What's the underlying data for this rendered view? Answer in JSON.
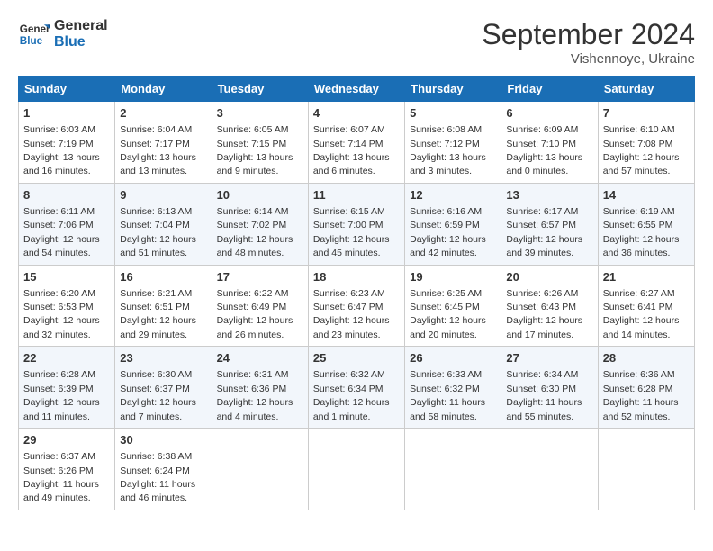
{
  "header": {
    "logo_line1": "General",
    "logo_line2": "Blue",
    "month": "September 2024",
    "location": "Vishennoye, Ukraine"
  },
  "days_of_week": [
    "Sunday",
    "Monday",
    "Tuesday",
    "Wednesday",
    "Thursday",
    "Friday",
    "Saturday"
  ],
  "weeks": [
    [
      {
        "day": "1",
        "sunrise": "6:03 AM",
        "sunset": "7:19 PM",
        "daylight": "13 hours and 16 minutes."
      },
      {
        "day": "2",
        "sunrise": "6:04 AM",
        "sunset": "7:17 PM",
        "daylight": "13 hours and 13 minutes."
      },
      {
        "day": "3",
        "sunrise": "6:05 AM",
        "sunset": "7:15 PM",
        "daylight": "13 hours and 9 minutes."
      },
      {
        "day": "4",
        "sunrise": "6:07 AM",
        "sunset": "7:14 PM",
        "daylight": "13 hours and 6 minutes."
      },
      {
        "day": "5",
        "sunrise": "6:08 AM",
        "sunset": "7:12 PM",
        "daylight": "13 hours and 3 minutes."
      },
      {
        "day": "6",
        "sunrise": "6:09 AM",
        "sunset": "7:10 PM",
        "daylight": "13 hours and 0 minutes."
      },
      {
        "day": "7",
        "sunrise": "6:10 AM",
        "sunset": "7:08 PM",
        "daylight": "12 hours and 57 minutes."
      }
    ],
    [
      {
        "day": "8",
        "sunrise": "6:11 AM",
        "sunset": "7:06 PM",
        "daylight": "12 hours and 54 minutes."
      },
      {
        "day": "9",
        "sunrise": "6:13 AM",
        "sunset": "7:04 PM",
        "daylight": "12 hours and 51 minutes."
      },
      {
        "day": "10",
        "sunrise": "6:14 AM",
        "sunset": "7:02 PM",
        "daylight": "12 hours and 48 minutes."
      },
      {
        "day": "11",
        "sunrise": "6:15 AM",
        "sunset": "7:00 PM",
        "daylight": "12 hours and 45 minutes."
      },
      {
        "day": "12",
        "sunrise": "6:16 AM",
        "sunset": "6:59 PM",
        "daylight": "12 hours and 42 minutes."
      },
      {
        "day": "13",
        "sunrise": "6:17 AM",
        "sunset": "6:57 PM",
        "daylight": "12 hours and 39 minutes."
      },
      {
        "day": "14",
        "sunrise": "6:19 AM",
        "sunset": "6:55 PM",
        "daylight": "12 hours and 36 minutes."
      }
    ],
    [
      {
        "day": "15",
        "sunrise": "6:20 AM",
        "sunset": "6:53 PM",
        "daylight": "12 hours and 32 minutes."
      },
      {
        "day": "16",
        "sunrise": "6:21 AM",
        "sunset": "6:51 PM",
        "daylight": "12 hours and 29 minutes."
      },
      {
        "day": "17",
        "sunrise": "6:22 AM",
        "sunset": "6:49 PM",
        "daylight": "12 hours and 26 minutes."
      },
      {
        "day": "18",
        "sunrise": "6:23 AM",
        "sunset": "6:47 PM",
        "daylight": "12 hours and 23 minutes."
      },
      {
        "day": "19",
        "sunrise": "6:25 AM",
        "sunset": "6:45 PM",
        "daylight": "12 hours and 20 minutes."
      },
      {
        "day": "20",
        "sunrise": "6:26 AM",
        "sunset": "6:43 PM",
        "daylight": "12 hours and 17 minutes."
      },
      {
        "day": "21",
        "sunrise": "6:27 AM",
        "sunset": "6:41 PM",
        "daylight": "12 hours and 14 minutes."
      }
    ],
    [
      {
        "day": "22",
        "sunrise": "6:28 AM",
        "sunset": "6:39 PM",
        "daylight": "12 hours and 11 minutes."
      },
      {
        "day": "23",
        "sunrise": "6:30 AM",
        "sunset": "6:37 PM",
        "daylight": "12 hours and 7 minutes."
      },
      {
        "day": "24",
        "sunrise": "6:31 AM",
        "sunset": "6:36 PM",
        "daylight": "12 hours and 4 minutes."
      },
      {
        "day": "25",
        "sunrise": "6:32 AM",
        "sunset": "6:34 PM",
        "daylight": "12 hours and 1 minute."
      },
      {
        "day": "26",
        "sunrise": "6:33 AM",
        "sunset": "6:32 PM",
        "daylight": "11 hours and 58 minutes."
      },
      {
        "day": "27",
        "sunrise": "6:34 AM",
        "sunset": "6:30 PM",
        "daylight": "11 hours and 55 minutes."
      },
      {
        "day": "28",
        "sunrise": "6:36 AM",
        "sunset": "6:28 PM",
        "daylight": "11 hours and 52 minutes."
      }
    ],
    [
      {
        "day": "29",
        "sunrise": "6:37 AM",
        "sunset": "6:26 PM",
        "daylight": "11 hours and 49 minutes."
      },
      {
        "day": "30",
        "sunrise": "6:38 AM",
        "sunset": "6:24 PM",
        "daylight": "11 hours and 46 minutes."
      },
      null,
      null,
      null,
      null,
      null
    ]
  ]
}
